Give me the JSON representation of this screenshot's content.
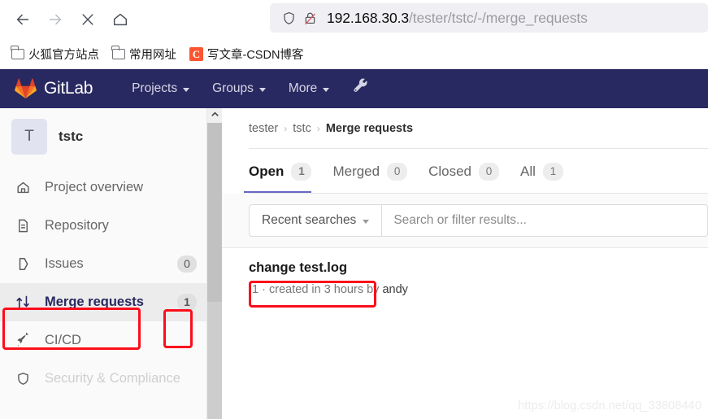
{
  "browser": {
    "toolbar": {
      "back_icon": "arrow-left-icon",
      "forward_icon": "arrow-right-icon",
      "stop_icon": "close-x-icon",
      "home_icon": "home-icon"
    },
    "urlbar": {
      "shield_icon": "shield-icon",
      "insecure_icon": "lock-crossed-out-icon",
      "host": "192.168.30.3",
      "path": "/tester/tstc/-/merge_requests",
      "full_url": "192.168.30.3/tester/tstc/-/merge_requests"
    },
    "bookmarks": [
      {
        "label": "火狐官方站点",
        "icon": "folder-icon"
      },
      {
        "label": "常用网址",
        "icon": "folder-icon"
      },
      {
        "label": "写文章-CSDN博客",
        "icon": "csdn-icon",
        "icon_letter": "C"
      }
    ]
  },
  "gitlab_navbar": {
    "brand": "GitLab",
    "logo_icon": "gitlab-fox-icon",
    "items": [
      {
        "label": "Projects",
        "caret": true
      },
      {
        "label": "Groups",
        "caret": true
      },
      {
        "label": "More",
        "caret": true
      }
    ],
    "wrench_icon": "wrench-icon",
    "background": "#292961"
  },
  "sidebar": {
    "project": {
      "avatar_letter": "T",
      "name": "tstc"
    },
    "items": [
      {
        "label": "Project overview",
        "icon": "home-icon",
        "count": null,
        "active": false
      },
      {
        "label": "Repository",
        "icon": "document-icon",
        "count": null,
        "active": false
      },
      {
        "label": "Issues",
        "icon": "issue-icon",
        "count": "0",
        "active": false
      },
      {
        "label": "Merge requests",
        "icon": "merge-request-icon",
        "count": "1",
        "active": true
      },
      {
        "label": "CI/CD",
        "icon": "rocket-icon",
        "count": null,
        "active": false
      },
      {
        "label": "Security & Compliance",
        "icon": "shield-icon",
        "count": null,
        "active": false
      }
    ],
    "scrollbar": {
      "up_arrow_icon": "chevron-up-icon"
    }
  },
  "main": {
    "breadcrumb": {
      "items": [
        "tester",
        "tstc"
      ],
      "current": "Merge requests",
      "separator": "›"
    },
    "tabs": [
      {
        "label": "Open",
        "count": "1",
        "active": true
      },
      {
        "label": "Merged",
        "count": "0",
        "active": false
      },
      {
        "label": "Closed",
        "count": "0",
        "active": false
      },
      {
        "label": "All",
        "count": "1",
        "active": false
      }
    ],
    "filter": {
      "recent_searches_label": "Recent searches",
      "search_placeholder": "Search or filter results..."
    },
    "merge_requests": [
      {
        "title": "change test.log",
        "reference": "!1",
        "meta_separator": "·",
        "meta": "created in 3 hours by",
        "author": "andy",
        "meta_full": "!1 · created in 3 hours by andy"
      }
    ]
  },
  "annotations": {
    "color": "#fc0d1b",
    "boxes": [
      {
        "name": "sidebar-merge-requests-highlight"
      },
      {
        "name": "sidebar-merge-requests-count-highlight"
      },
      {
        "name": "merge-request-title-highlight"
      }
    ]
  },
  "watermark": {
    "text": "https://blog.csdn.net/qq_33808440"
  }
}
